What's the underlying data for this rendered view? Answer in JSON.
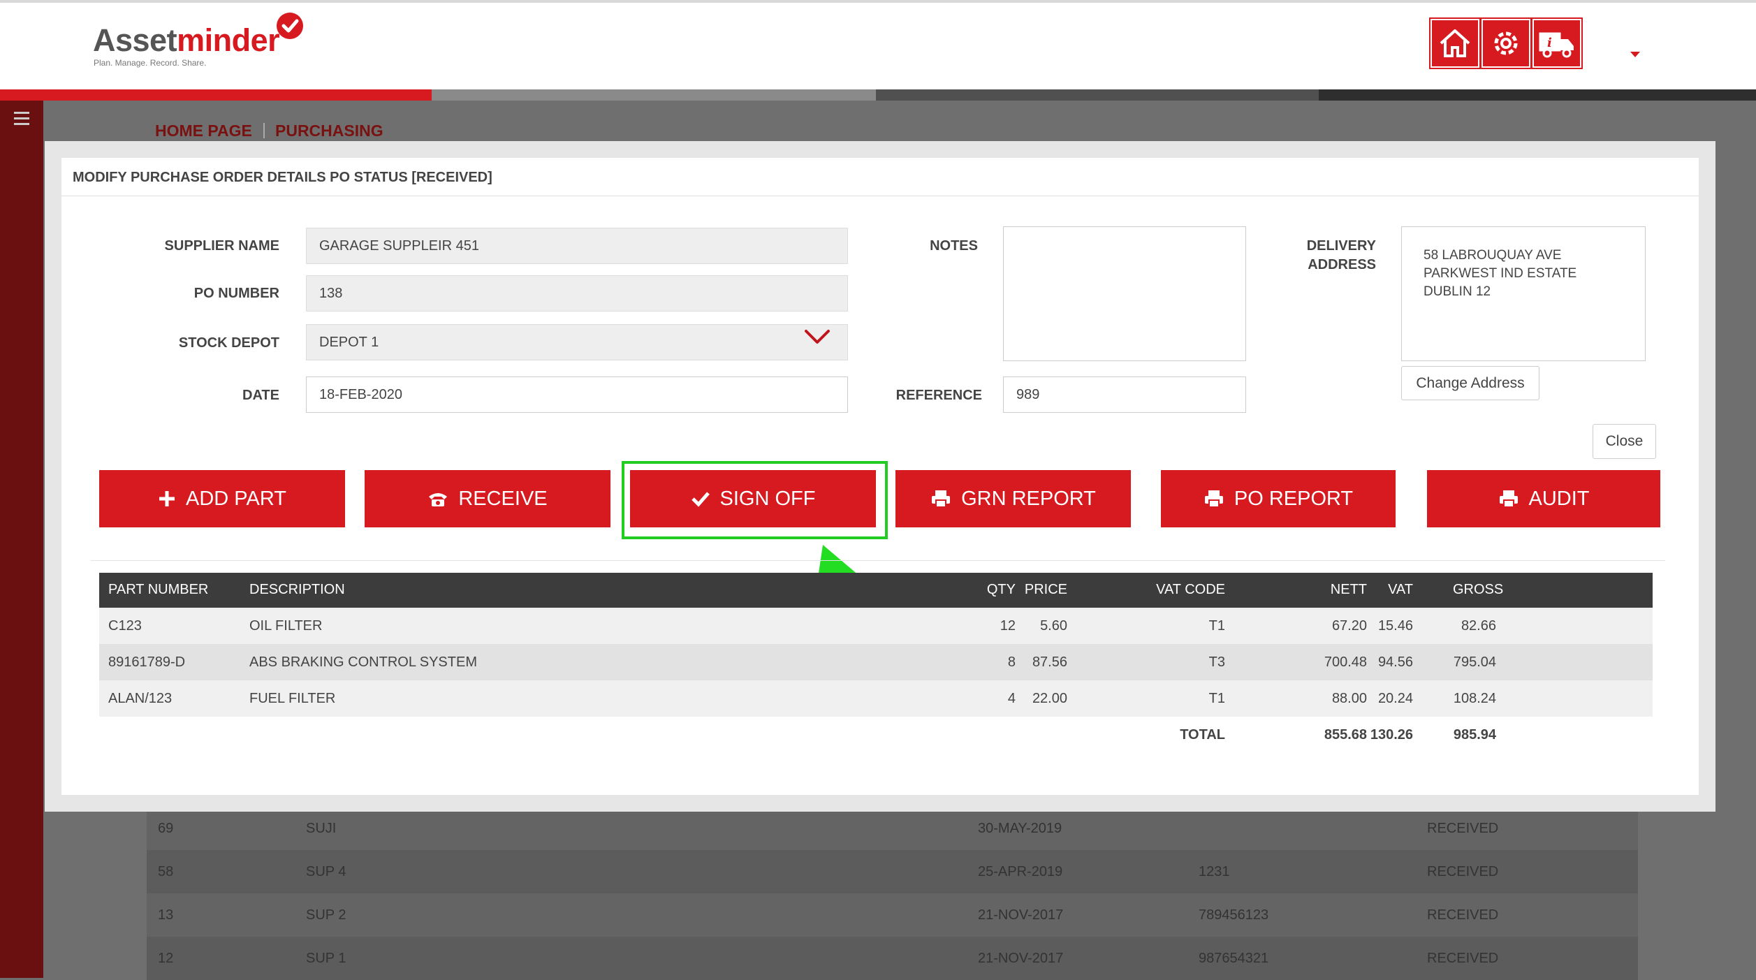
{
  "header": {
    "logo_main": "Asset",
    "logo_accent": "minder",
    "tagline": "Plan. Manage. Record. Share.",
    "icons": [
      "home-icon",
      "settings-icon",
      "truck-info-icon"
    ]
  },
  "breadcrumb": {
    "home": "HOME PAGE",
    "current": "PURCHASING"
  },
  "modal": {
    "title": "MODIFY PURCHASE ORDER DETAILS PO STATUS [RECEIVED]",
    "supplier_label": "SUPPLIER NAME",
    "supplier_value": "GARAGE SUPPLEIR 451",
    "po_label": "PO NUMBER",
    "po_value": "138",
    "depot_label": "STOCK DEPOT",
    "depot_value": "DEPOT 1",
    "date_label": "DATE",
    "date_value": "18-FEB-2020",
    "notes_label": "NOTES",
    "reference_label": "REFERENCE",
    "reference_value": "989",
    "delivery_label_1": "DELIVERY",
    "delivery_label_2": "ADDRESS",
    "address_line1": "58 LABROUQUAY AVE",
    "address_line2": "PARKWEST IND ESTATE",
    "address_line3": "DUBLIN 12",
    "change_address": "Change Address",
    "close": "Close"
  },
  "actions": {
    "add_part": "ADD PART",
    "receive": "RECEIVE",
    "sign_off": "SIGN OFF",
    "grn_report": "GRN REPORT",
    "po_report": "PO REPORT",
    "audit": "AUDIT"
  },
  "parts_table": {
    "headers": {
      "part": "PART NUMBER",
      "desc": "DESCRIPTION",
      "qty": "QTY",
      "price": "PRICE",
      "vat_code": "VAT CODE",
      "nett": "NETT",
      "vat": "VAT",
      "gross": "GROSS"
    },
    "rows": [
      {
        "part": "C123",
        "desc": "OIL FILTER",
        "qty": "12",
        "price": "5.60",
        "vat_code": "T1",
        "nett": "67.20",
        "vat": "15.46",
        "gross": "82.66"
      },
      {
        "part": "89161789-D",
        "desc": "ABS BRAKING CONTROL SYSTEM",
        "qty": "8",
        "price": "87.56",
        "vat_code": "T3",
        "nett": "700.48",
        "vat": "94.56",
        "gross": "795.04"
      },
      {
        "part": "ALAN/123",
        "desc": "FUEL FILTER",
        "qty": "4",
        "price": "22.00",
        "vat_code": "T1",
        "nett": "88.00",
        "vat": "20.24",
        "gross": "108.24"
      }
    ],
    "total_label": "TOTAL",
    "total_nett": "855.68",
    "total_vat": "130.26",
    "total_gross": "985.94"
  },
  "background_list": [
    {
      "id": "69",
      "supplier": "SUJI",
      "date": "30-MAY-2019",
      "ref": "",
      "status": "RECEIVED"
    },
    {
      "id": "58",
      "supplier": "SUP 4",
      "date": "25-APR-2019",
      "ref": "1231",
      "status": "RECEIVED"
    },
    {
      "id": "13",
      "supplier": "SUP 2",
      "date": "21-NOV-2017",
      "ref": "789456123",
      "status": "RECEIVED"
    },
    {
      "id": "12",
      "supplier": "SUP 1",
      "date": "21-NOV-2017",
      "ref": "987654321",
      "status": "RECEIVED"
    }
  ],
  "colors": {
    "accent": "#d71920",
    "sidebar": "#6b1010",
    "highlight": "#22cc22",
    "table_header": "#3c3c3c"
  }
}
